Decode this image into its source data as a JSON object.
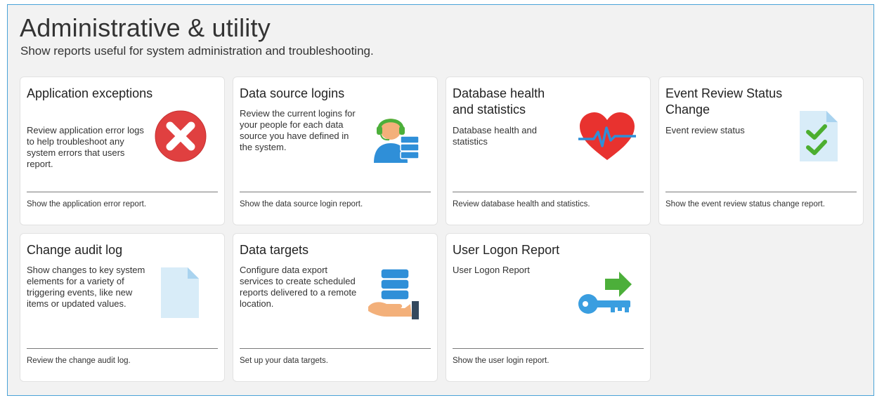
{
  "header": {
    "title": "Administrative & utility",
    "subtitle": "Show reports useful for system administration and troubleshooting."
  },
  "cards": [
    {
      "title": "Application exceptions",
      "description": "Review application error logs to help troubleshoot any system errors that users report.",
      "link": "Show the application error report.",
      "icon": "error-x-icon"
    },
    {
      "title": "Data source logins",
      "description": "Review the current logins for your people for each data source you have defined in the system.",
      "link": "Show the data source login report.",
      "icon": "user-headset-database-icon"
    },
    {
      "title": "Database health and statistics",
      "description": "Database health and statistics",
      "link": "Review database health and statistics.",
      "icon": "heart-pulse-icon"
    },
    {
      "title": "Event Review Status Change",
      "description": "Event review status",
      "link": "Show the event review status change report.",
      "icon": "document-checkmarks-icon"
    },
    {
      "title": "Change audit log",
      "description": "Show changes to key system elements for a variety of triggering events, like new items or updated values.",
      "link": "Review the change audit log.",
      "icon": "blank-document-icon"
    },
    {
      "title": "Data targets",
      "description": "Configure data export services to create scheduled reports delivered to a remote location.",
      "link": "Set up your data targets.",
      "icon": "hand-database-icon"
    },
    {
      "title": "User Logon Report",
      "description": "User Logon Report",
      "link": "Show the user login report.",
      "icon": "key-arrow-icon"
    }
  ],
  "colors": {
    "panel_border": "#4aa3d8",
    "panel_background": "#f2f2f2",
    "error_red": "#e04040",
    "heart_red": "#e8322f",
    "check_green": "#4cae2f",
    "database_blue": "#2f8fd8",
    "key_blue": "#3a9ee0",
    "arrow_green": "#4caf3a"
  }
}
